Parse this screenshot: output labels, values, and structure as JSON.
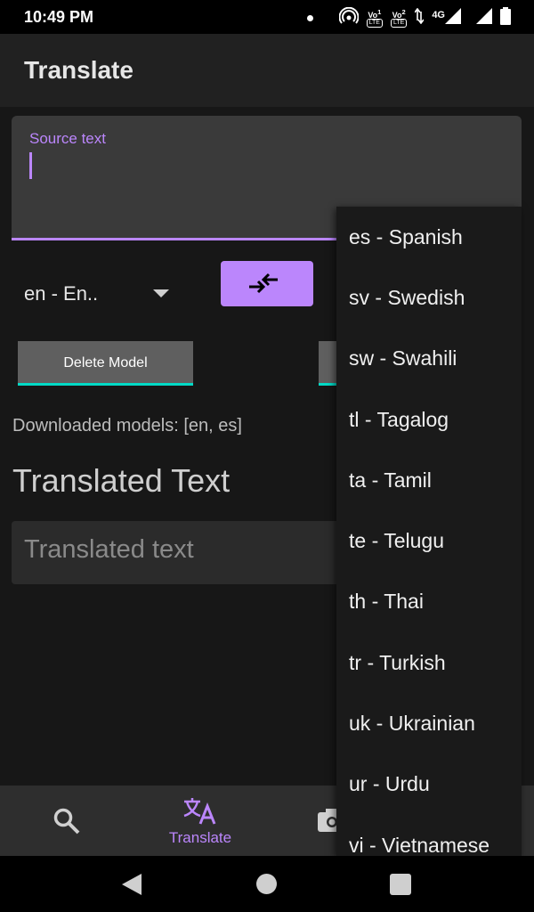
{
  "status_bar": {
    "time": "10:49 PM",
    "volte1": {
      "top": "Vo",
      "num": "1",
      "bottom": "LTE"
    },
    "volte2": {
      "top": "Vo",
      "num": "2",
      "bottom": "LTE"
    },
    "network": "4G"
  },
  "app_bar": {
    "title": "Translate"
  },
  "source": {
    "label": "Source text",
    "value": ""
  },
  "language": {
    "selected": "en - En.."
  },
  "buttons": {
    "delete_model": "Delete Model"
  },
  "downloaded_models": "Downloaded models: [en, es]",
  "translated": {
    "heading": "Translated Text",
    "placeholder": "Translated text"
  },
  "bottom_nav": {
    "translate_label": "Translate"
  },
  "dropdown": {
    "items": [
      "es - Spanish",
      "sv - Swedish",
      "sw - Swahili",
      "tl - Tagalog",
      "ta - Tamil",
      "te - Telugu",
      "th - Thai",
      "tr - Turkish",
      "uk - Ukrainian",
      "ur - Urdu",
      "vi - Vietnamese"
    ]
  },
  "colors": {
    "accent": "#bb86fc",
    "teal": "#03dac6",
    "background": "#171717"
  }
}
